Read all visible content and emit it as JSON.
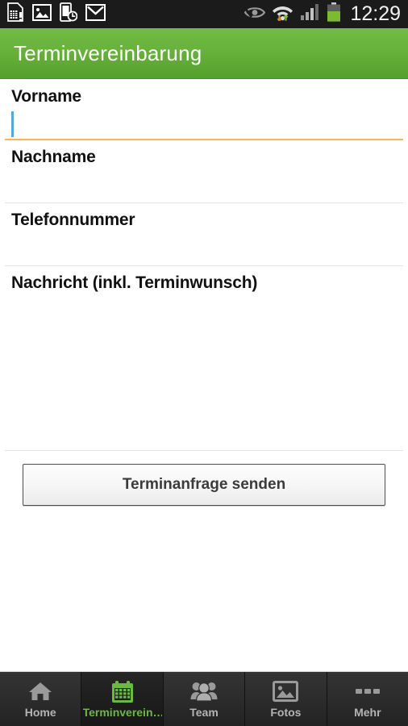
{
  "statusbar": {
    "icons_left": [
      "sim-card-icon",
      "gallery-icon",
      "phone-clock-icon",
      "gmail-icon"
    ],
    "icons_right": [
      "smart-stay-eye-icon",
      "wifi-transfer-icon",
      "signal-bars-icon",
      "battery-icon"
    ],
    "time": "12:29"
  },
  "header": {
    "title": "Terminvereinbarung",
    "background_color": "#66b23a"
  },
  "form": {
    "fields": [
      {
        "label": "Vorname",
        "value": "",
        "placeholder": "",
        "focused": true
      },
      {
        "label": "Nachname",
        "value": "",
        "placeholder": "",
        "focused": false
      },
      {
        "label": "Telefonnummer",
        "value": "",
        "placeholder": "",
        "focused": false
      },
      {
        "label": "Nachricht (inkl. Terminwunsch)",
        "value": "",
        "placeholder": "",
        "focused": false
      }
    ],
    "submit_label": "Terminanfrage senden",
    "focus_underline_color": "#f5b84f",
    "caret_color": "#4fa9e8"
  },
  "tabbar": {
    "active_color": "#69bb3c",
    "inactive_color": "#b4b4b4",
    "tabs": [
      {
        "label": "Home",
        "icon": "home-icon",
        "active": false
      },
      {
        "label": "Terminverein…",
        "icon": "calendar-icon",
        "active": true
      },
      {
        "label": "Team",
        "icon": "people-icon",
        "active": false
      },
      {
        "label": "Fotos",
        "icon": "photo-icon",
        "active": false
      },
      {
        "label": "Mehr",
        "icon": "more-dots-icon",
        "active": false
      }
    ]
  }
}
